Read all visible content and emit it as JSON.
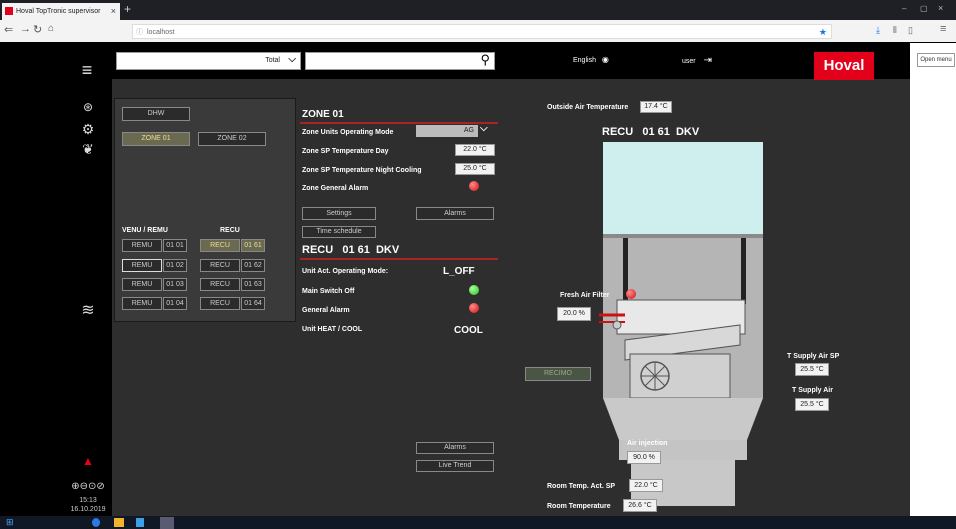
{
  "browser": {
    "tab_title": "Hoval TopTronic supervisor",
    "tab_close": "×",
    "new_tab": "+",
    "url": "localhost",
    "open_menu": "Open menu",
    "window_controls": [
      "–",
      "▢",
      "×"
    ]
  },
  "header": {
    "total_label": "Total",
    "search_placeholder": "",
    "language": "English",
    "user": "user",
    "brand": "Hoval"
  },
  "sidebar": {
    "time": "15:13",
    "date": "16.10.2019"
  },
  "left_panel": {
    "dhw_button": "DHW",
    "zone_buttons": [
      "ZONE 01",
      "ZONE 02"
    ],
    "venu_remu_heading": "VENU / REMU",
    "recu_heading": "RECU",
    "remu_units": [
      {
        "label": "REMU",
        "num": "01 01"
      },
      {
        "label": "REMU",
        "num": "01 02"
      },
      {
        "label": "REMU",
        "num": "01 03"
      },
      {
        "label": "REMU",
        "num": "01 04"
      }
    ],
    "recu_units": [
      {
        "label": "RECU",
        "num": "01 61"
      },
      {
        "label": "RECU",
        "num": "01 62"
      },
      {
        "label": "RECU",
        "num": "01 63"
      },
      {
        "label": "RECU",
        "num": "01 64"
      }
    ]
  },
  "zone": {
    "title": "ZONE 01",
    "rows": [
      {
        "label": "Zone Units Operating Mode",
        "value": "AG"
      },
      {
        "label": "Zone SP Temperature Day",
        "value": "22.0 °C"
      },
      {
        "label": "Zone SP Temperature Night Cooling",
        "value": "25.0 °C"
      },
      {
        "label": "Zone General Alarm",
        "value": ""
      }
    ],
    "settings_button": "Settings",
    "alarms_button": "Alarms",
    "time_schedule_button": "Time schedule"
  },
  "unit": {
    "title": "RECU   01 61  DKV",
    "rows": [
      {
        "label": "Unit Act. Operating Mode:",
        "value": "L_OFF"
      },
      {
        "label": "Main Switch Off",
        "value": ""
      },
      {
        "label": "General Alarm",
        "value": ""
      },
      {
        "label": "Unit HEAT / COOL",
        "value": "COOL"
      }
    ],
    "alarms_button": "Alarms",
    "live_trend_button": "Live Trend"
  },
  "diagram": {
    "outside_air_label": "Outside Air Temperature",
    "outside_air_value": "17.4 °C",
    "unit_title": "RECU   01 61  DKV",
    "fresh_air_filter_label": "Fresh Air Filter",
    "damper_value": "20.0 %",
    "mode_button": "RECIMO",
    "t_supply_sp_label": "T Supply Air SP",
    "t_supply_sp_value": "25.5 °C",
    "t_supply_label": "T Supply Air",
    "t_supply_value": "25.5 °C",
    "air_injection_label": "Air injection",
    "air_injection_value": "90.0 %",
    "room_sp_label": "Room Temp. Act. SP",
    "room_sp_value": "22.0 °C",
    "room_temp_label": "Room Temperature",
    "room_temp_value": "26.6 °C"
  },
  "colors": {
    "brand_red": "#e2001a",
    "alarm_red": "#d01010",
    "ok_green": "#28c028",
    "panel_bg": "#2e2e2e"
  }
}
